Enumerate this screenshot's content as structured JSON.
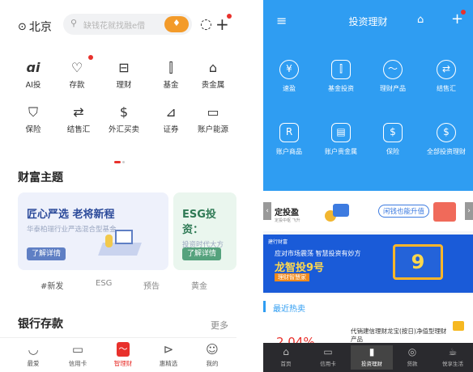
{
  "left": {
    "location": "北京",
    "search_placeholder": "缺钱花就找融e借",
    "grid_row1": [
      {
        "label": "AI投",
        "icon": "ai-icon"
      },
      {
        "label": "存款",
        "icon": "piggy-bank-icon"
      },
      {
        "label": "理财",
        "icon": "wealth-icon"
      },
      {
        "label": "基金",
        "icon": "fund-chart-icon"
      },
      {
        "label": "贵金属",
        "icon": "gold-bars-icon"
      }
    ],
    "grid_row2": [
      {
        "label": "保险",
        "icon": "shield-icon"
      },
      {
        "label": "结售汇",
        "icon": "exchange-icon"
      },
      {
        "label": "外汇买卖",
        "icon": "forex-icon"
      },
      {
        "label": "证券",
        "icon": "stock-chart-icon"
      },
      {
        "label": "账户能源",
        "icon": "wallet-icon"
      }
    ],
    "section1_title": "财富主题",
    "card1": {
      "title": "匠心严选 老将新程",
      "subtitle": "华泰柏瑞行业严选混合型基金",
      "button": "了解详情"
    },
    "card2": {
      "title": "ESG投资：",
      "subtitle": "投资时代大方",
      "button": "了解详情"
    },
    "tags": [
      "#新发",
      "ESG",
      "预告",
      "黄金"
    ],
    "section2_title": "银行存款",
    "more": "更多",
    "nav": [
      {
        "label": "最爱",
        "icon": "home-smile-icon"
      },
      {
        "label": "信用卡",
        "icon": "credit-card-icon"
      },
      {
        "label": "智理财",
        "icon": "chart-active-icon"
      },
      {
        "label": "惠精选",
        "icon": "tag-icon"
      },
      {
        "label": "我的",
        "icon": "user-icon"
      }
    ],
    "active_color": "#e8312c"
  },
  "right": {
    "title": "投资理财",
    "row1": [
      {
        "label": "速盈",
        "icon": "yen-circle-icon"
      },
      {
        "label": "基金投资",
        "icon": "fund-icon"
      },
      {
        "label": "理财产品",
        "icon": "trend-icon"
      },
      {
        "label": "结售汇",
        "icon": "exchange-icon"
      }
    ],
    "row2": [
      {
        "label": "账户商品",
        "icon": "account-goods-icon"
      },
      {
        "label": "账户贵金属",
        "icon": "gold-icon"
      },
      {
        "label": "保险",
        "icon": "insurance-icon"
      },
      {
        "label": "全部投资理财",
        "icon": "dollar-circle-icon"
      }
    ],
    "strip": {
      "left_title": "定投盈",
      "left_sub": "定投中枢 飞升",
      "right_title": "闲钱也能升值"
    },
    "banner": {
      "brand": "建行财富",
      "line1": "应对市场震荡 智慧投资有妙方",
      "headline": "龙智投9号",
      "sub": "理财智慧家"
    },
    "hot_title": "最近热卖",
    "hot_text": "代销建信理财龙宝(按日)净值型理财产品",
    "hot_rate": "2.04%",
    "nav": [
      {
        "label": "首页",
        "icon": "home-icon"
      },
      {
        "label": "信用卡",
        "icon": "card-icon"
      },
      {
        "label": "投资理财",
        "icon": "bars-icon"
      },
      {
        "label": "贷款",
        "icon": "loan-icon"
      },
      {
        "label": "悦享生活",
        "icon": "cup-icon"
      }
    ],
    "accent": "#2f9df2"
  }
}
